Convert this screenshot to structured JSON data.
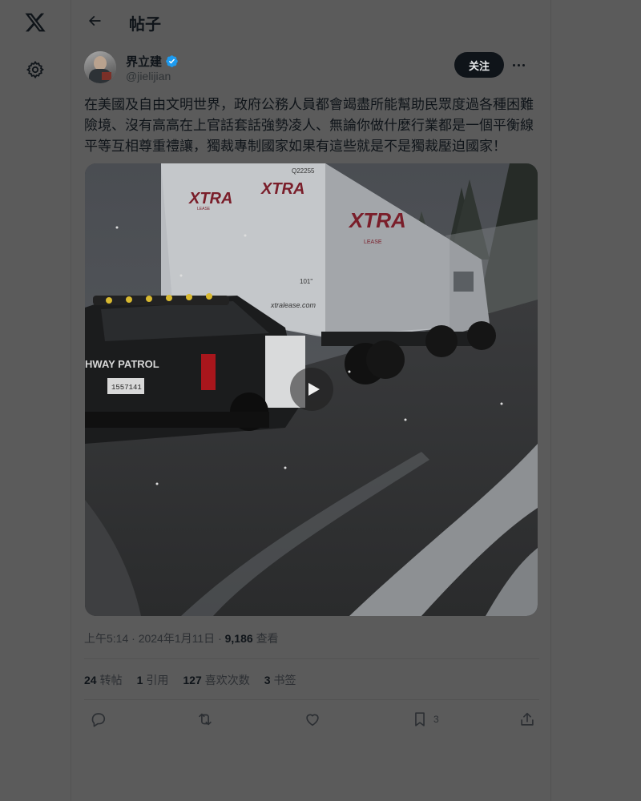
{
  "nav": {
    "logo_icon": "x-logo-icon",
    "settings_icon": "gear-icon"
  },
  "header": {
    "title": "帖子",
    "back_icon": "arrow-left-icon"
  },
  "post": {
    "author": {
      "name": "界立建",
      "handle": "@jielijian",
      "verified": true
    },
    "follow_label": "关注",
    "more_icon": "ellipsis-icon",
    "text": "在美國及自由文明世界，政府公務人員都會竭盡所能幫助民眾度過各種困難險境、沒有高高在上官話套話強勢凌人、無論你做什麼行業都是一個平衡線平等互相尊重禮讓，獨裁專制國家如果有這些就是不是獨裁壓迫國家！",
    "media": {
      "type": "video",
      "play_icon": "play-icon",
      "scene_text": {
        "trailer_id": "Q22255",
        "brand_1": "XTRA",
        "brand_2": "XTRA",
        "brand_side": "XTRA",
        "lease_small": "LEASE",
        "lease_side": "LEASE",
        "trailer_size": "101\"",
        "url": "xtralease.com",
        "patrol": "HWAY   PATROL",
        "plate": "1557141"
      }
    },
    "time": "上午5:14",
    "date": "2024年1月11日",
    "views": "9,186",
    "views_label": "查看",
    "stats": [
      {
        "count": "24",
        "label": "转帖"
      },
      {
        "count": "1",
        "label": "引用"
      },
      {
        "count": "127",
        "label": "喜欢次数"
      },
      {
        "count": "3",
        "label": "书签"
      }
    ],
    "actions": {
      "reply_icon": "reply-icon",
      "repost_icon": "repost-icon",
      "like_icon": "heart-icon",
      "bookmark_icon": "bookmark-icon",
      "bookmark_count": "3",
      "share_icon": "share-icon"
    }
  },
  "colors": {
    "overlay_bg": "#5b5b5b",
    "text": "#0f1419",
    "verified": "#1d9bf0",
    "follow_bg": "#0f1419"
  }
}
